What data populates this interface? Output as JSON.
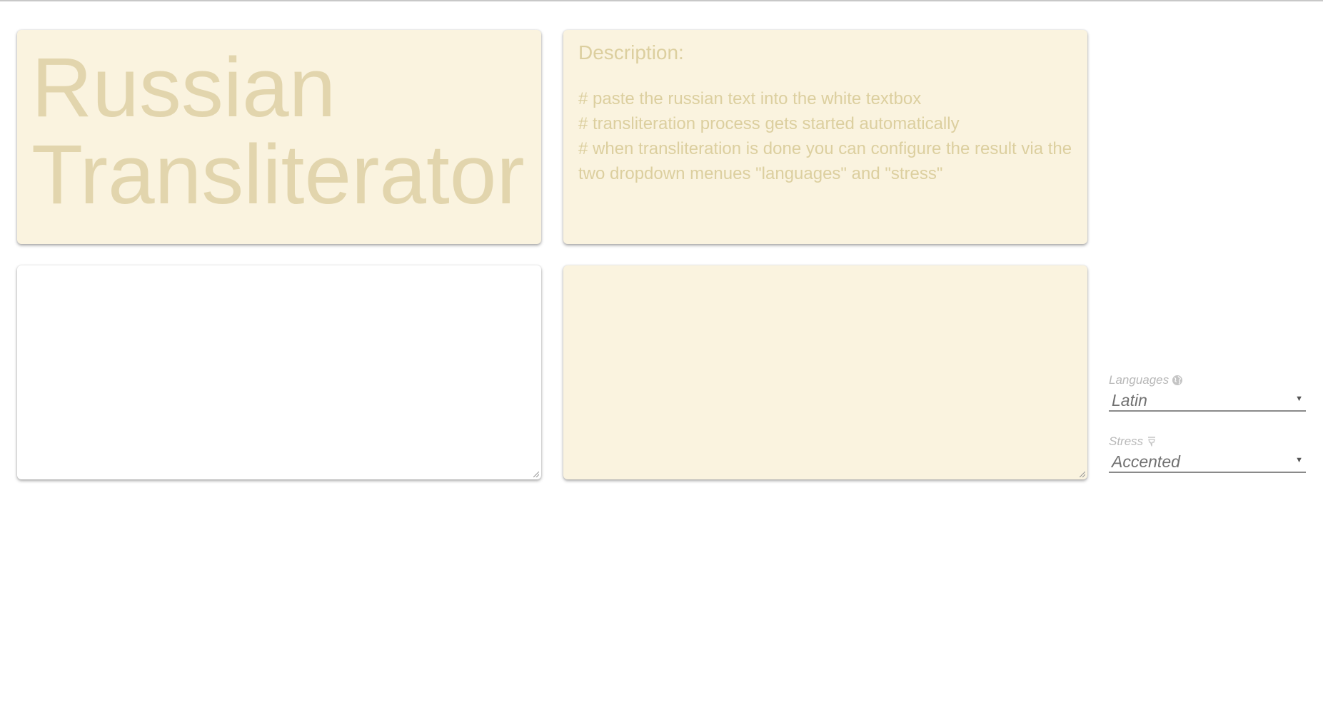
{
  "app": {
    "title": "Russian Transliterator"
  },
  "description": {
    "heading": "Description:",
    "lines": [
      "# paste the russian text into the white textbox",
      "# transliteration process gets started automatically",
      "# when transliteration is done you can configure the result via the two dropdown menues \"languages\" and \"stress\""
    ]
  },
  "input": {
    "value": ""
  },
  "output": {
    "value": ""
  },
  "controls": {
    "languages": {
      "label": "Languages",
      "icon": "globe-icon",
      "selected": "Latin"
    },
    "stress": {
      "label": "Stress",
      "icon": "stress-accent-icon",
      "selected": "Accented"
    }
  },
  "colors": {
    "card_background": "#faf3df",
    "title_text": "#e2d5ad",
    "description_text": "#dccf9f",
    "input_background": "#ffffff"
  }
}
